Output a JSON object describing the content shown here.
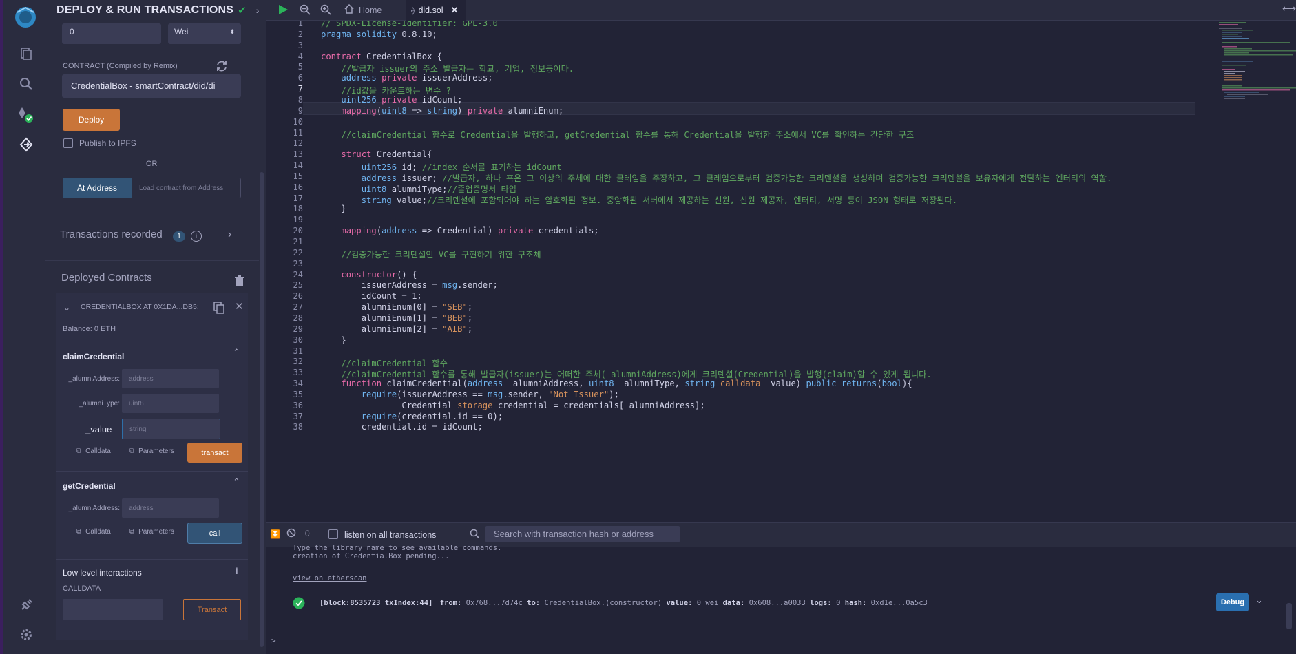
{
  "side": {
    "title": "DEPLOY & RUN TRANSACTIONS",
    "value_input": "0",
    "value_unit": "Wei",
    "contract_label": "CONTRACT (Compiled by Remix)",
    "contract_select": "CredentialBox - smartContract/did/di",
    "deploy_label": "Deploy",
    "publish_label": "Publish to IPFS",
    "or_label": "OR",
    "at_address_label": "At Address",
    "load_placeholder": "Load contract from Address",
    "tx_recorded_label": "Transactions recorded",
    "tx_recorded_count": "1",
    "deployed_label": "Deployed Contracts",
    "instance_label": "CREDENTIALBOX AT 0X1DA...DB5:",
    "balance": "Balance: 0 ETH",
    "claim": {
      "name": "claimCredential",
      "params": [
        {
          "label": "_alumniAddress:",
          "placeholder": "address"
        },
        {
          "label": "_alumniType:",
          "placeholder": "uint8"
        },
        {
          "label": "_value",
          "placeholder": "string"
        }
      ],
      "calldata": "Calldata",
      "parameters": "Parameters",
      "action": "transact"
    },
    "get": {
      "name": "getCredential",
      "params": [
        {
          "label": "_alumniAddress:",
          "placeholder": "address"
        }
      ],
      "calldata": "Calldata",
      "parameters": "Parameters",
      "action": "call"
    },
    "low_level_label": "Low level interactions",
    "calldata_label": "CALLDATA",
    "transact_label": "Transact"
  },
  "tabs": {
    "home": "Home",
    "file": "did.sol"
  },
  "code": [
    "// SPDX-License-Identifier: GPL-3.0",
    "pragma solidity 0.8.10;",
    "",
    "contract CredentialBox {",
    "    //발급자 issuer의 주소 발급자는 학교, 기업, 정보등이다.",
    "    address private issuerAddress;",
    "    //id값을 카운트하는 변수 ?",
    "    uint256 private idCount;",
    "    mapping(uint8 => string) private alumniEnum;",
    "",
    "    //claimCredential 함수로 Credential을 발행하고, getCredential 함수를 통해 Credential을 발행한 주소에서 VC를 확인하는 간단한 구조",
    "",
    "    struct Credential{",
    "        uint256 id; //index 순서를 표기하는 idCount",
    "        address issuer; //발급자, 하나 혹은 그 이상의 주체에 대한 클레임을 주장하고, 그 클레임으로부터 검증가능한 크리덴셜을 생성하며 검증가능한 크리덴셜을 보유자에게 전달하는 엔터티의 역할.",
    "        uint8 alumniType;//졸업증명서 타입",
    "        string value;//크리덴셜에 포함되어야 하는 암호화된 정보. 중앙화된 서버에서 제공하는 신원, 신원 제공자, 엔터티, 서명 등이 JSON 형태로 저장된다.",
    "    }",
    "",
    "    mapping(address => Credential) private credentials;",
    "",
    "    //검증가능한 크리덴셜인 VC를 구현하기 위한 구조체",
    "",
    "    constructor() {",
    "        issuerAddress = msg.sender;",
    "        idCount = 1;",
    "        alumniEnum[0] = \"SEB\";",
    "        alumniEnum[1] = \"BEB\";",
    "        alumniEnum[2] = \"AIB\";",
    "    }",
    "",
    "    //claimCredential 함수",
    "    //claimCredential 함수를 통해 발급자(issuer)는 어떠한 주체(_alumniAddress)에게 크리덴셜(Credential)을 발행(claim)할 수 있게 됩니다.",
    "    function claimCredential(address _alumniAddress, uint8 _alumniType, string calldata _value) public returns(bool){",
    "        require(issuerAddress == msg.sender, \"Not Issuer\");",
    "                Credential storage credential = credentials[_alumniAddress];",
    "        require(credential.id == 0);",
    "        credential.id = idCount;"
  ],
  "terminal": {
    "count": "0",
    "listen_label": "listen on all transactions",
    "search_placeholder": "Search with transaction hash or address",
    "line1": "Type the library name to see available commands.",
    "line2": "creation of CredentialBox pending...",
    "etherscan": "view on etherscan",
    "tx_block": "[block:8535723 txIndex:44]",
    "tx_from_label": "from:",
    "tx_from": "0x768...7d74c",
    "tx_to_label": "to:",
    "tx_to": "CredentialBox.(constructor)",
    "tx_value_label": "value:",
    "tx_value": "0 wei",
    "tx_data_label": "data:",
    "tx_data": "0x608...a0033",
    "tx_logs_label": "logs:",
    "tx_logs": "0",
    "tx_hash_label": "hash:",
    "tx_hash": "0xd1e...0a5c3",
    "debug_label": "Debug",
    "prompt": ">"
  }
}
